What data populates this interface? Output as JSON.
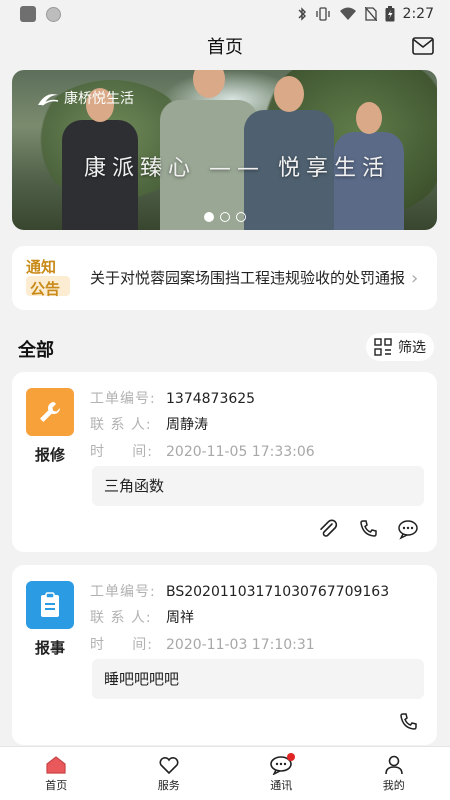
{
  "status_bar": {
    "time": "2:27"
  },
  "header": {
    "title": "首页"
  },
  "banner": {
    "brand": "康桥悦生活",
    "slogan": "康派臻心 —— 悦享生活",
    "pages": 3,
    "active_page": 1
  },
  "notice": {
    "badge_line1": "通知",
    "badge_line2": "公告",
    "text": "关于对悦蓉园案场围挡工程违规验收的处罚通报"
  },
  "section": {
    "title": "全部",
    "filter_label": "筛选"
  },
  "orders": [
    {
      "type_label": "报修",
      "type_icon": "wrench-icon",
      "type_color": "#f7a13b",
      "order_no_label": "工单编号:",
      "order_no": "1374873625",
      "contact_label": "联 系 人:",
      "contact": "周静涛",
      "time_label": "时     间:",
      "time": "2020-11-05 17:33:06",
      "description": "三角函数",
      "actions": [
        "attachment-icon",
        "phone-icon",
        "message-icon"
      ]
    },
    {
      "type_label": "报事",
      "type_icon": "clipboard-icon",
      "type_color": "#2b9be3",
      "order_no_label": "工单编号:",
      "order_no": "BS20201103171030767709163",
      "contact_label": "联 系 人:",
      "contact": "周祥",
      "time_label": "时     间:",
      "time": "2020-11-03 17:10:31",
      "description": "睡吧吧吧吧",
      "actions": [
        "phone-icon"
      ]
    }
  ],
  "tabbar": {
    "items": [
      {
        "label": "首页",
        "icon": "home-icon",
        "active": true
      },
      {
        "label": "服务",
        "icon": "heart-icon",
        "active": false
      },
      {
        "label": "通讯",
        "icon": "chat-icon",
        "active": false,
        "badge": true
      },
      {
        "label": "我的",
        "icon": "person-icon",
        "active": false
      }
    ]
  },
  "colors": {
    "accent": "#e9585b",
    "background": "#f2f2f2"
  }
}
